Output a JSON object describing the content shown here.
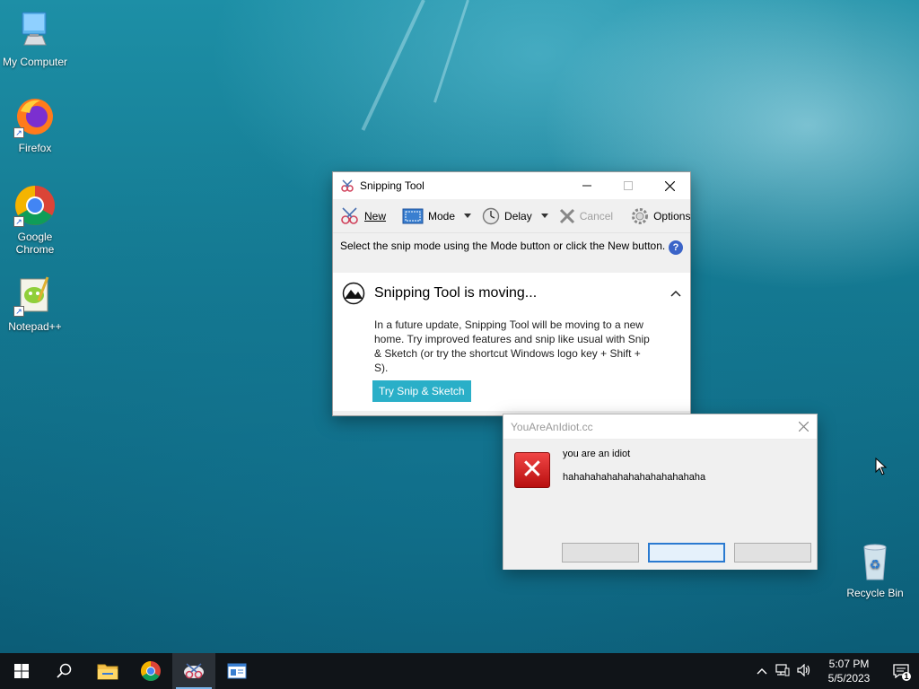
{
  "desktop": {
    "icons": [
      {
        "label": "My Computer"
      },
      {
        "label": "Firefox"
      },
      {
        "label": "Google Chrome"
      },
      {
        "label": "Notepad++"
      },
      {
        "label": "Recycle Bin"
      }
    ]
  },
  "snipping_tool": {
    "title": "Snipping Tool",
    "toolbar": {
      "new_label": "New",
      "mode_label": "Mode",
      "delay_label": "Delay",
      "cancel_label": "Cancel",
      "options_label": "Options"
    },
    "hint": "Select the snip mode using the Mode button or click the New button.",
    "banner": {
      "title": "Snipping Tool is moving...",
      "body": "In a future update, Snipping Tool will be moving to a new home. Try improved features and snip like usual with Snip & Sketch (or try the shortcut Windows logo key + Shift + S).",
      "button_label": "Try Snip & Sketch"
    }
  },
  "dialog": {
    "title": "YouAreAnIdiot.cc",
    "line1": "you are an idiot",
    "line2": "hahahahahahahahahahahahaha"
  },
  "taskbar": {
    "time": "5:07 PM",
    "date": "5/5/2023",
    "notification_count": "1"
  },
  "colors": {
    "accent": "#2aafc8",
    "error": "#d42020",
    "taskbar": "#101418"
  }
}
